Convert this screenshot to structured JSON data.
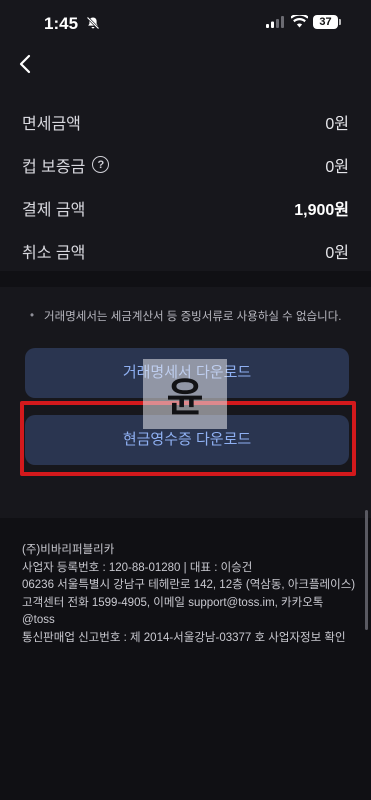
{
  "status_bar": {
    "time": "1:45",
    "battery": "37"
  },
  "icons": {
    "back": "chevron-left-icon",
    "bell": "bell-slash-icon",
    "help": "question-circle-icon"
  },
  "rows": [
    {
      "label": "면세금액",
      "value": "0원"
    },
    {
      "label": "컵 보증금",
      "value": "0원",
      "help": "?"
    },
    {
      "label": "결제 금액",
      "value": "1,900원"
    },
    {
      "label": "취소 금액",
      "value": "0원"
    }
  ],
  "notice": {
    "bullet": "•",
    "text": "거래명세서는 세금계산서 등 증빙서류로 사용하실 수 없습니다."
  },
  "buttons": {
    "statement_download": "거래명세서 다운로드",
    "receipt_download": "현금영수증 다운로드"
  },
  "watermark": "윤",
  "footer": {
    "lines": [
      "(주)비바리퍼블리카",
      "사업자 등록번호 : 120-88-01280 | 대표 : 이승건",
      "06236 서울특별시 강남구 테헤란로 142, 12층 (역삼동, 아크플레이스)",
      "고객센터 전화 1599-4905, 이메일 support@toss.im, 카카오톡",
      "@toss",
      "통신판매업 신고번호 : 제 2014-서울강남-03377 호 사업자정보 확인"
    ]
  },
  "colors": {
    "background": "#17171c",
    "button_bg": "#2a3550",
    "button_text": "#8fb0f2",
    "highlight": "#d3191c"
  }
}
